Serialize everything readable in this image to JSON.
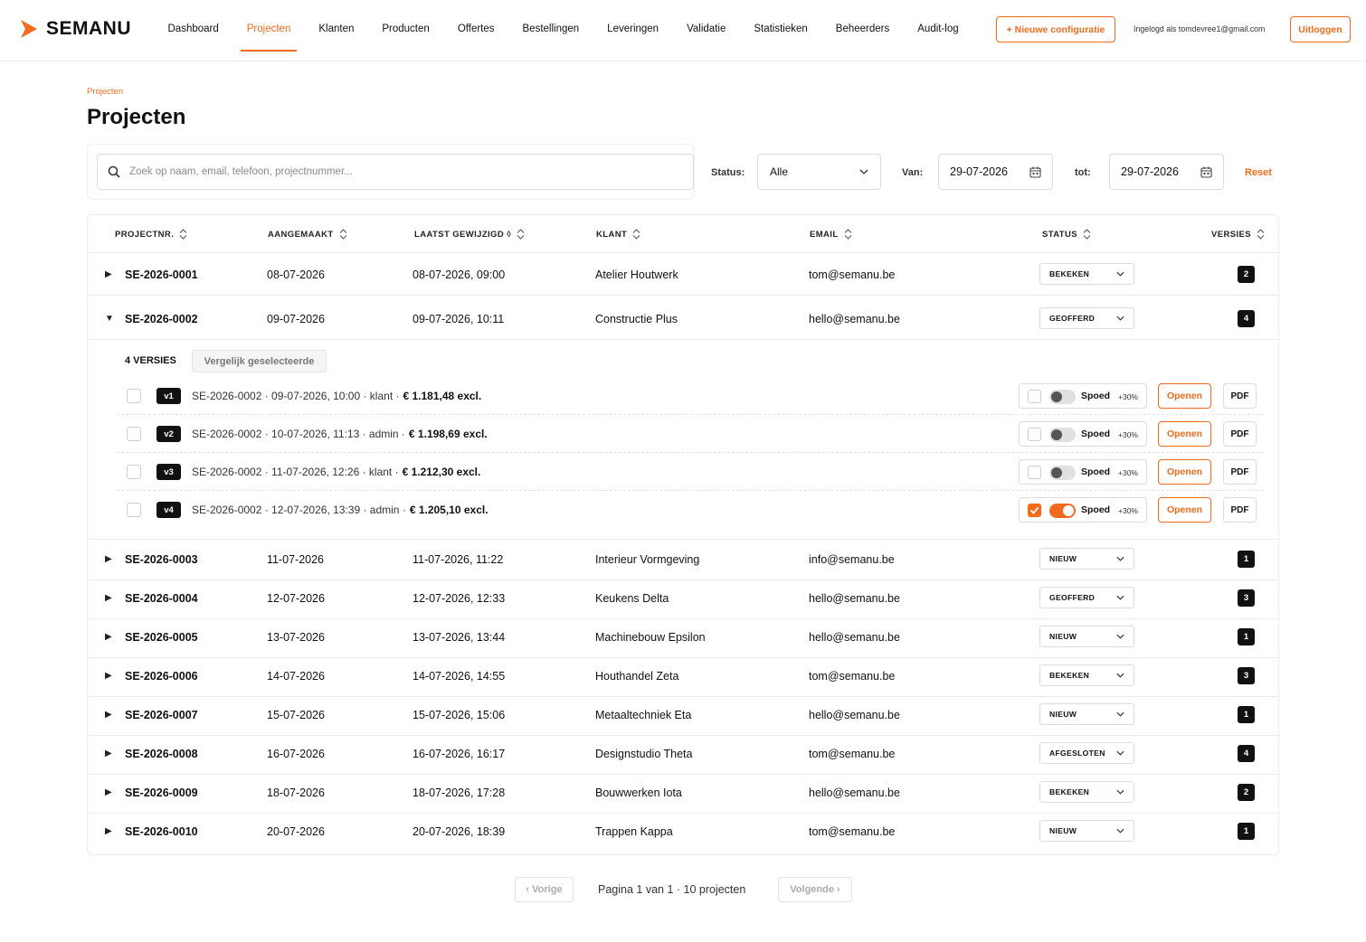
{
  "brand": {
    "name": "SEMANU",
    "accent": "#f26b1d"
  },
  "nav": {
    "items": [
      {
        "label": "Dashboard",
        "active": false
      },
      {
        "label": "Projecten",
        "active": true
      },
      {
        "label": "Klanten",
        "active": false
      },
      {
        "label": "Producten",
        "active": false
      },
      {
        "label": "Offertes",
        "active": false
      },
      {
        "label": "Bestellingen",
        "active": false
      },
      {
        "label": "Leveringen",
        "active": false
      },
      {
        "label": "Validatie",
        "active": false
      },
      {
        "label": "Statistieken",
        "active": false
      },
      {
        "label": "Beheerders",
        "active": false
      },
      {
        "label": "Audit-log",
        "active": false
      }
    ],
    "new_config_label": "+ Nieuwe configuratie",
    "logged_in_text": "Ingelogd als tomdevree1@gmail.com",
    "logout_label": "Uitloggen"
  },
  "page": {
    "breadcrumb": "Projecten",
    "title": "Projecten"
  },
  "filters": {
    "search_placeholder": "Zoek op naam, email, telefoon, projectnummer...",
    "status_label": "Status:",
    "status_value": "Alle",
    "from_label": "Van:",
    "from_value": "29-07-2026",
    "to_label": "tot:",
    "to_value": "29-07-2026",
    "reset_label": "Reset"
  },
  "table": {
    "headers": {
      "project": "PROJECTNR.",
      "created": "AANGEMAAKT",
      "modified": "LAATST GEWIJZIGD ◊",
      "client": "KLANT",
      "email": "EMAIL",
      "status": "STATUS",
      "versions": "VERSIES"
    },
    "rows": [
      {
        "id": "SE-2026-0001",
        "created": "08-07-2026",
        "modified": "08-07-2026, 09:00",
        "client": "Atelier Houtwerk",
        "email": "tom@semanu.be",
        "status": "BEKEKEN",
        "versions": "2",
        "expanded": false
      },
      {
        "id": "SE-2026-0002",
        "created": "09-07-2026",
        "modified": "09-07-2026, 10:11",
        "client": "Constructie Plus",
        "email": "hello@semanu.be",
        "status": "GEOFFERD",
        "versions": "4",
        "expanded": true
      },
      {
        "id": "SE-2026-0003",
        "created": "11-07-2026",
        "modified": "11-07-2026, 11:22",
        "client": "Interieur Vormgeving",
        "email": "info@semanu.be",
        "status": "NIEUW",
        "versions": "1",
        "expanded": false
      },
      {
        "id": "SE-2026-0004",
        "created": "12-07-2026",
        "modified": "12-07-2026, 12:33",
        "client": "Keukens Delta",
        "email": "hello@semanu.be",
        "status": "GEOFFERD",
        "versions": "3",
        "expanded": false
      },
      {
        "id": "SE-2026-0005",
        "created": "13-07-2026",
        "modified": "13-07-2026, 13:44",
        "client": "Machinebouw Epsilon",
        "email": "hello@semanu.be",
        "status": "NIEUW",
        "versions": "1",
        "expanded": false
      },
      {
        "id": "SE-2026-0006",
        "created": "14-07-2026",
        "modified": "14-07-2026, 14:55",
        "client": "Houthandel Zeta",
        "email": "tom@semanu.be",
        "status": "BEKEKEN",
        "versions": "3",
        "expanded": false
      },
      {
        "id": "SE-2026-0007",
        "created": "15-07-2026",
        "modified": "15-07-2026, 15:06",
        "client": "Metaaltechniek Eta",
        "email": "hello@semanu.be",
        "status": "NIEUW",
        "versions": "1",
        "expanded": false
      },
      {
        "id": "SE-2026-0008",
        "created": "16-07-2026",
        "modified": "16-07-2026, 16:17",
        "client": "Designstudio Theta",
        "email": "tom@semanu.be",
        "status": "AFGESLOTEN",
        "versions": "4",
        "expanded": false
      },
      {
        "id": "SE-2026-0009",
        "created": "18-07-2026",
        "modified": "18-07-2026, 17:28",
        "client": "Bouwwerken Iota",
        "email": "hello@semanu.be",
        "status": "BEKEKEN",
        "versions": "2",
        "expanded": false
      },
      {
        "id": "SE-2026-0010",
        "created": "20-07-2026",
        "modified": "20-07-2026, 18:39",
        "client": "Trappen Kappa",
        "email": "tom@semanu.be",
        "status": "NIEUW",
        "versions": "1",
        "expanded": false
      }
    ]
  },
  "versions_panel": {
    "title": "4 VERSIES",
    "compare_label": "Vergelijk geselecteerde",
    "spoed_label": "Spoed",
    "spoed_pct": "+30%",
    "open_label": "Openen",
    "pdf_label": "PDF",
    "items": [
      {
        "tag": "v1",
        "text": "SE-2026-0002 · 09-07-2026, 10:00 · klant ·",
        "price": "€ 1.181,48 excl.",
        "spoed": false
      },
      {
        "tag": "v2",
        "text": "SE-2026-0002 · 10-07-2026, 11:13 · admin ·",
        "price": "€ 1.198,69 excl.",
        "spoed": false
      },
      {
        "tag": "v3",
        "text": "SE-2026-0002 · 11-07-2026, 12:26 · klant ·",
        "price": "€ 1.212,30 excl.",
        "spoed": false
      },
      {
        "tag": "v4",
        "text": "SE-2026-0002 · 12-07-2026, 13:39 · admin ·",
        "price": "€ 1.205,10 excl.",
        "spoed": true
      }
    ]
  },
  "pagination": {
    "prev_label": "‹ Vorige",
    "info": "Pagina 1 van 1 · 10 projecten",
    "next_label": "Volgende ›"
  }
}
